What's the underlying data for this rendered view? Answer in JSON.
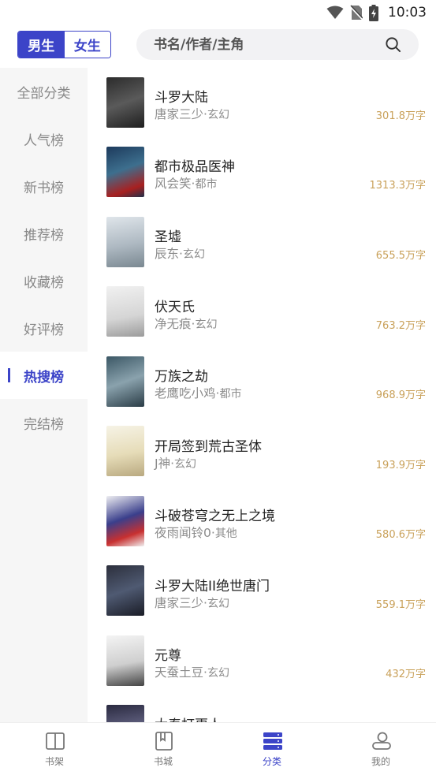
{
  "status_bar": {
    "time": "10:03"
  },
  "header": {
    "gender_tabs": [
      {
        "label": "男生",
        "active": true
      },
      {
        "label": "女生",
        "active": false
      }
    ],
    "search": {
      "placeholder": "书名/作者/主角"
    }
  },
  "sidebar": {
    "items": [
      {
        "label": "全部分类",
        "active": false
      },
      {
        "label": "人气榜",
        "active": false
      },
      {
        "label": "新书榜",
        "active": false
      },
      {
        "label": "推荐榜",
        "active": false
      },
      {
        "label": "收藏榜",
        "active": false
      },
      {
        "label": "好评榜",
        "active": false
      },
      {
        "label": "热搜榜",
        "active": true
      },
      {
        "label": "完结榜",
        "active": false
      }
    ]
  },
  "books": [
    {
      "title": "斗罗大陆",
      "author": "唐家三少",
      "genre": "玄幻",
      "count": "301.8万字"
    },
    {
      "title": "都市极品医神",
      "author": "风会笑",
      "genre": "都市",
      "count": "1313.3万字"
    },
    {
      "title": "圣墟",
      "author": "辰东",
      "genre": "玄幻",
      "count": "655.5万字"
    },
    {
      "title": "伏天氏",
      "author": "净无痕",
      "genre": "玄幻",
      "count": "763.2万字"
    },
    {
      "title": "万族之劫",
      "author": "老鹰吃小鸡",
      "genre": "都市",
      "count": "968.9万字"
    },
    {
      "title": "开局签到荒古圣体",
      "author": "J神",
      "genre": "玄幻",
      "count": "193.9万字"
    },
    {
      "title": "斗破苍穹之无上之境",
      "author": "夜雨闻铃0",
      "genre": "其他",
      "count": "580.6万字"
    },
    {
      "title": "斗罗大陆II绝世唐门",
      "author": "唐家三少",
      "genre": "玄幻",
      "count": "559.1万字"
    },
    {
      "title": "元尊",
      "author": "天蚕土豆",
      "genre": "玄幻",
      "count": "432万字"
    },
    {
      "title": "大秦打更人",
      "author": "",
      "genre": "",
      "count": ""
    }
  ],
  "bottom_nav": {
    "items": [
      {
        "label": "书架",
        "icon": "bookshelf-icon",
        "active": false
      },
      {
        "label": "书城",
        "icon": "bookstore-icon",
        "active": false
      },
      {
        "label": "分类",
        "icon": "category-icon",
        "active": true
      },
      {
        "label": "我的",
        "icon": "profile-icon",
        "active": false
      }
    ]
  },
  "colors": {
    "accent": "#3c44c8",
    "word_count": "#c9a15a",
    "sidebar_bg": "#f6f6f6"
  }
}
